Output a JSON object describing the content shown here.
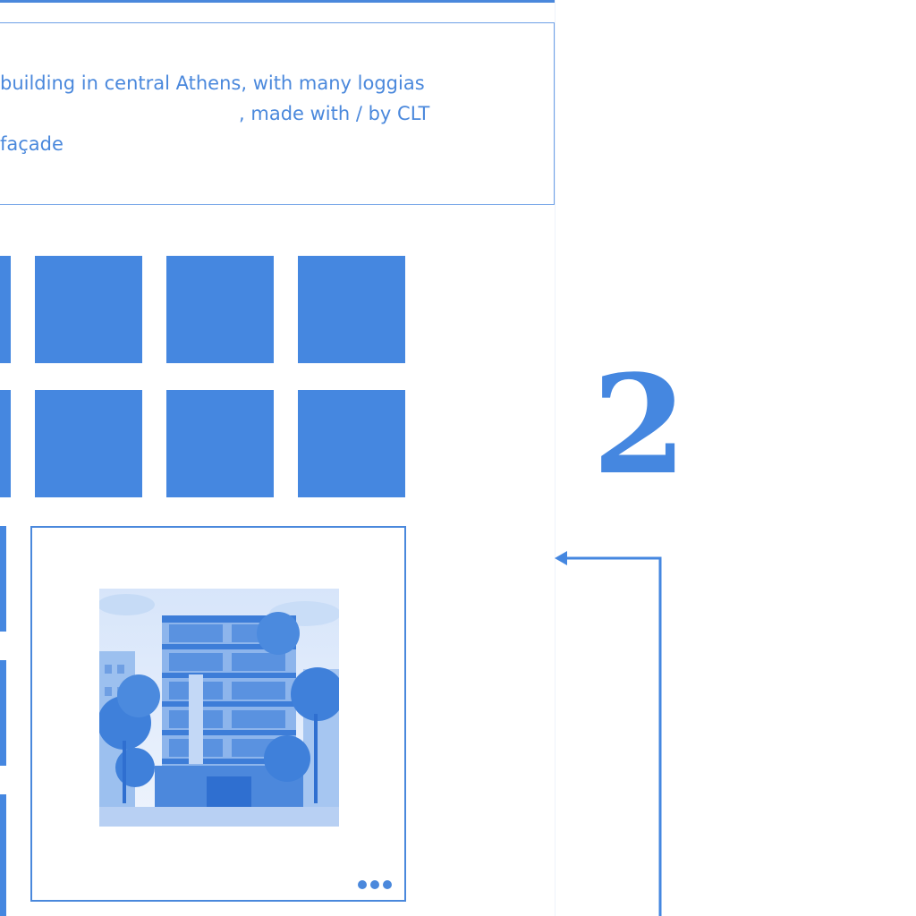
{
  "prompt": {
    "line1": "building in central Athens, with many loggias",
    "line2": "                                        , made with / by CLT",
    "line3": "façade"
  },
  "thumbnails": {
    "rows": 2,
    "columns_visible": 4
  },
  "selected_result": {
    "image_alt": "Generated image of a multi-storey building with loggias and trees",
    "more_icon": "more-dots-icon"
  },
  "step": {
    "number": "2"
  },
  "connector_icon": "arrow-left-icon",
  "colors": {
    "accent": "#4587e0",
    "border": "#6ea0e6",
    "background": "#ffffff"
  }
}
